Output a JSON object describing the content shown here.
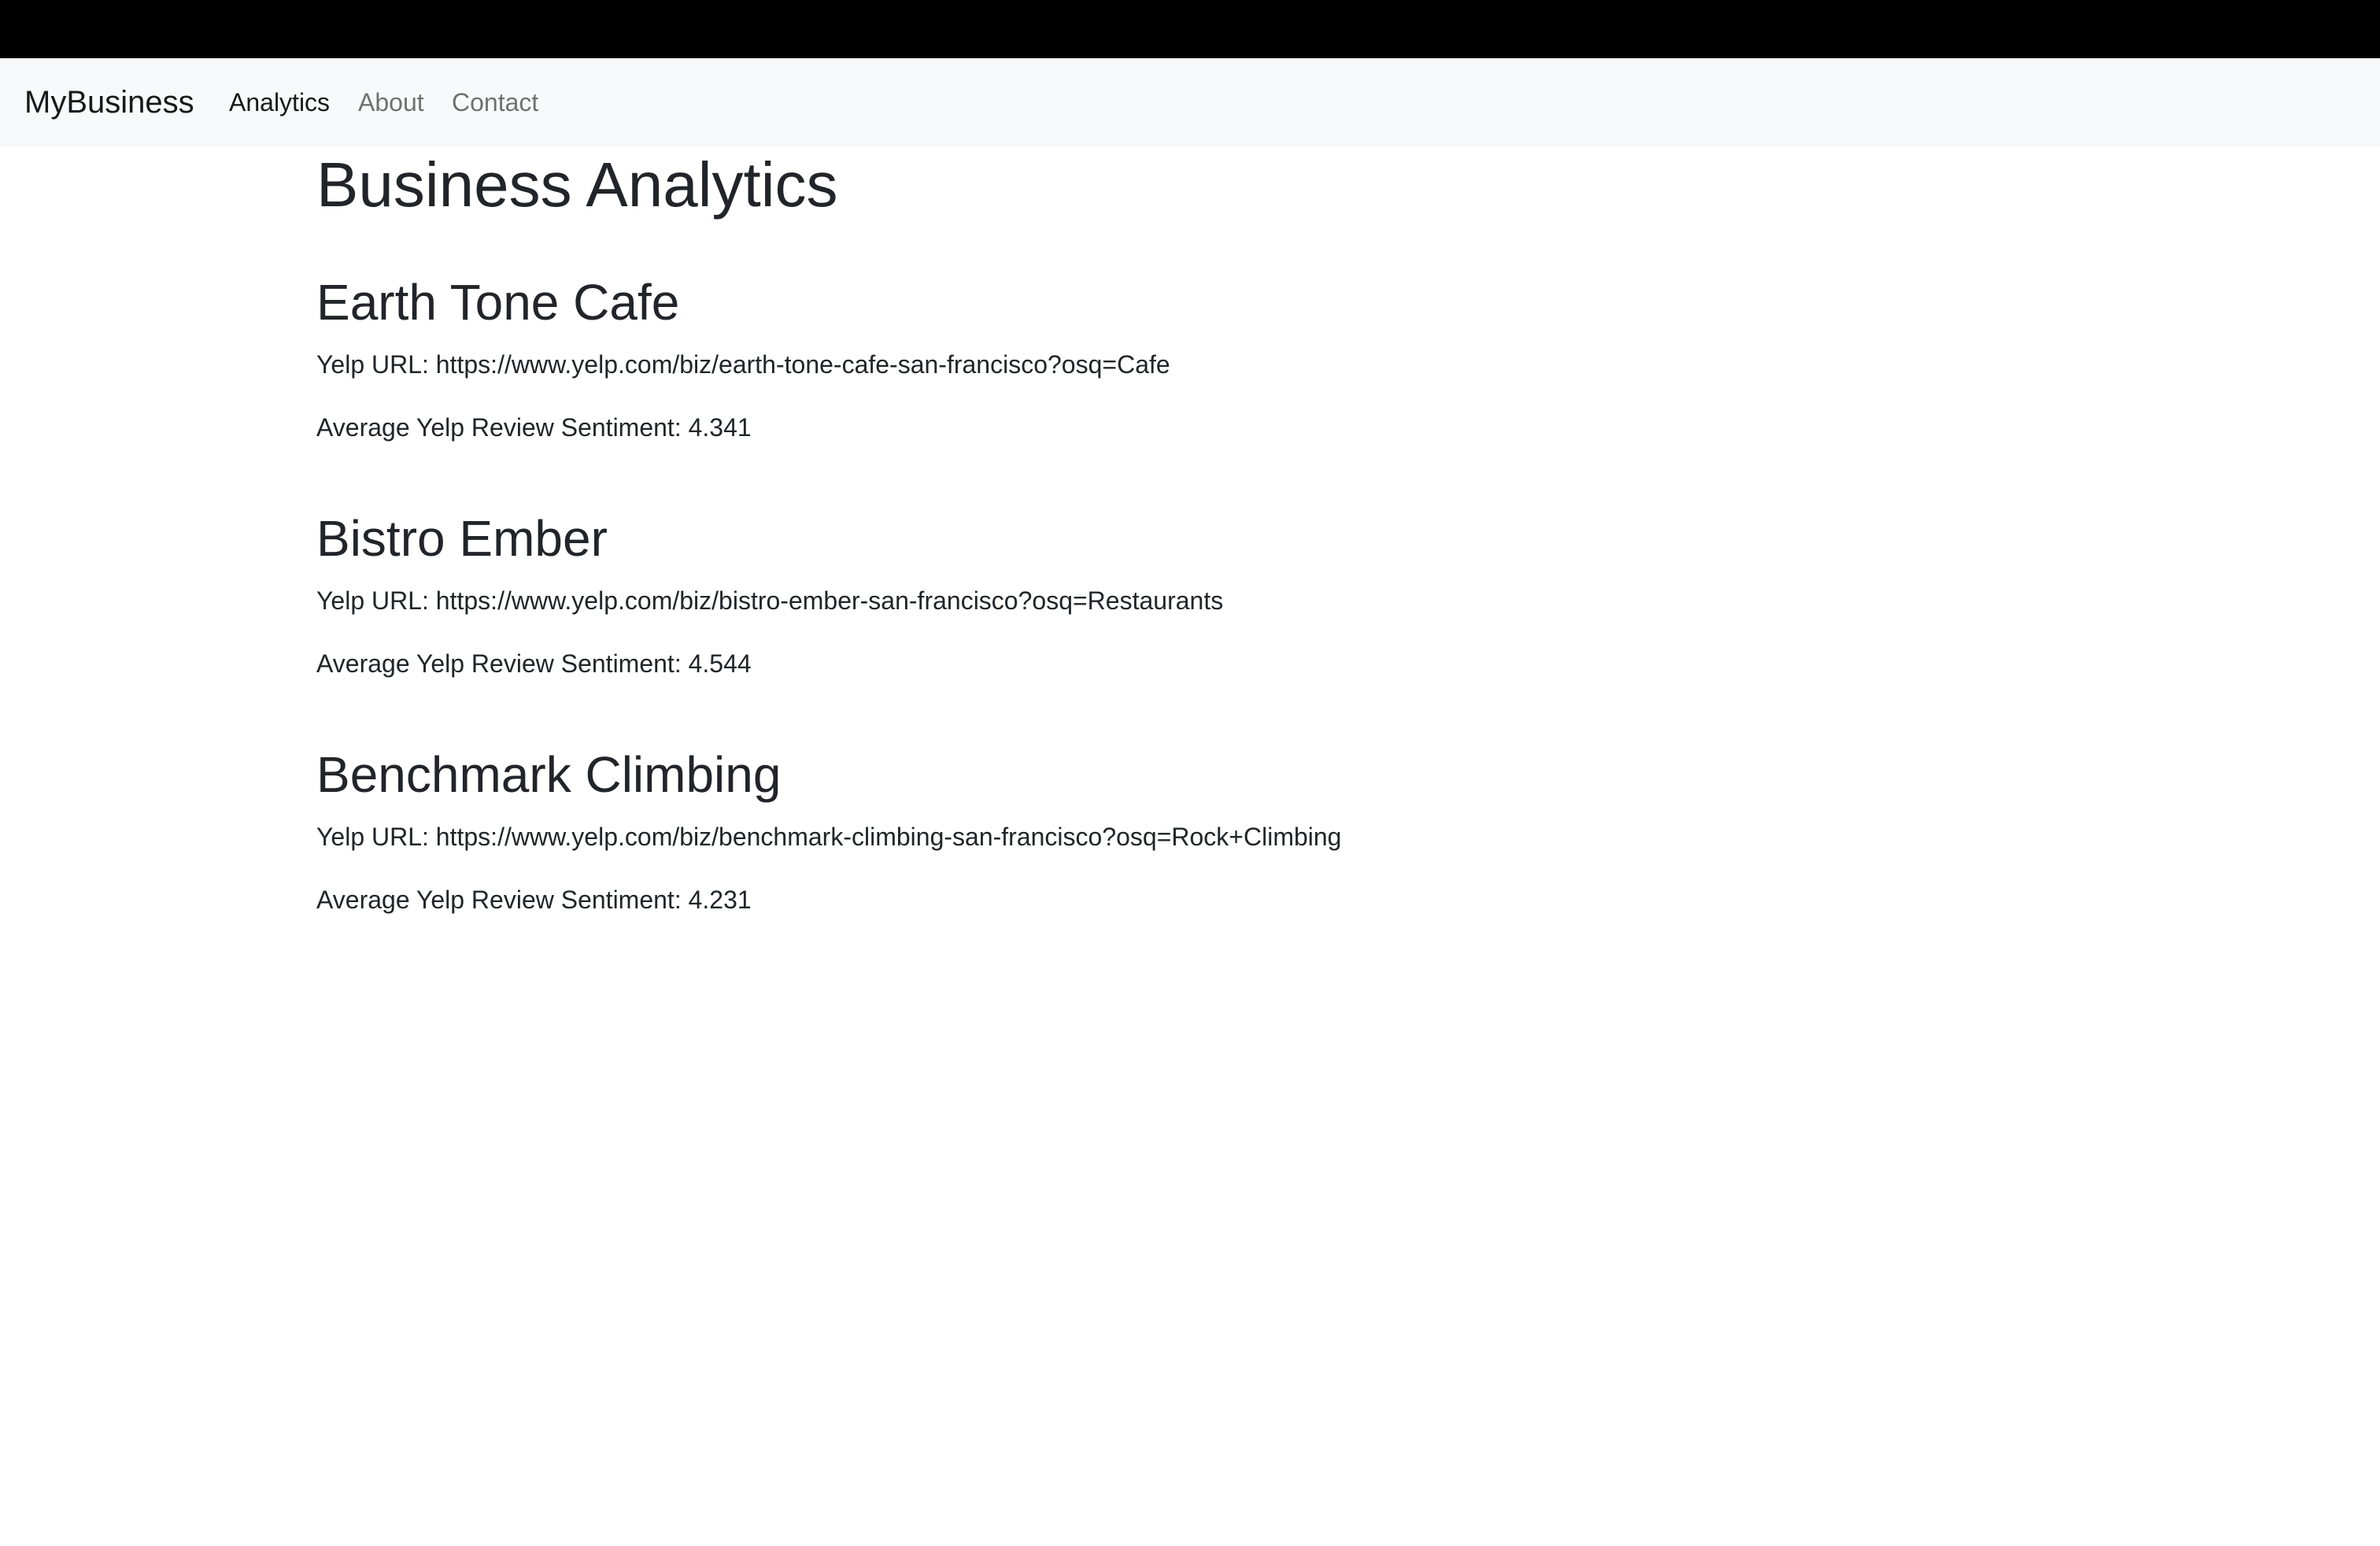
{
  "navbar": {
    "brand": "MyBusiness",
    "links": [
      {
        "label": "Analytics",
        "active": true
      },
      {
        "label": "About",
        "active": false
      },
      {
        "label": "Contact",
        "active": false
      }
    ]
  },
  "main": {
    "title": "Business Analytics",
    "businesses": [
      {
        "name": "Earth Tone Cafe",
        "url_line": "Yelp URL: https://www.yelp.com/biz/earth-tone-cafe-san-francisco?osq=Cafe",
        "sentiment_line": "Average Yelp Review Sentiment: 4.341"
      },
      {
        "name": "Bistro Ember",
        "url_line": "Yelp URL: https://www.yelp.com/biz/bistro-ember-san-francisco?osq=Restaurants",
        "sentiment_line": "Average Yelp Review Sentiment: 4.544"
      },
      {
        "name": "Benchmark Climbing",
        "url_line": "Yelp URL: https://www.yelp.com/biz/benchmark-climbing-san-francisco?osq=Rock+Climbing",
        "sentiment_line": "Average Yelp Review Sentiment: 4.231"
      }
    ]
  },
  "colors": {
    "top_bar": "#000000",
    "navbar_bg": "#f8f9fa",
    "text": "#212529"
  }
}
